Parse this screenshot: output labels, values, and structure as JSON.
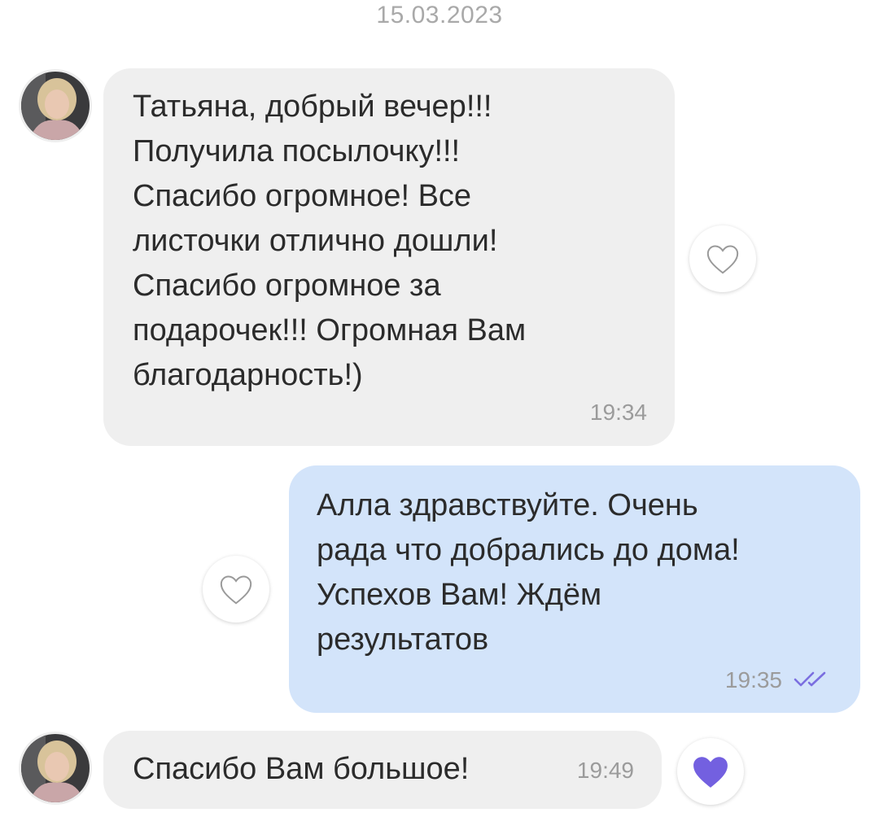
{
  "chat": {
    "date_separator": "15.03.2023",
    "messages": [
      {
        "direction": "incoming",
        "text": "Татьяна, добрый вечер!!!\nПолучила посылочку!!!\nСпасибо огромное! Все\nлисточки отлично дошли!\nСпасибо огромное за\nподарочек!!! Огромная Вам\nблагодарность!)",
        "time": "19:34",
        "liked": false,
        "like_icon": "heart-outline-icon"
      },
      {
        "direction": "outgoing",
        "text": "Алла здравствуйте.  Очень\nрада что добрались до дома!\nУспехов Вам! Ждём\nрезультатов",
        "time": "19:35",
        "status_icon": "double-check-icon",
        "liked": false,
        "like_icon": "heart-outline-icon"
      },
      {
        "direction": "incoming",
        "text": "Спасибо Вам большое!",
        "time": "19:49",
        "liked": true,
        "like_icon": "heart-filled-icon"
      }
    ]
  },
  "colors": {
    "incoming_bubble": "#efefef",
    "outgoing_bubble": "#d3e4fa",
    "accent_heart": "#7360e0",
    "read_check": "#7b6fe0"
  }
}
